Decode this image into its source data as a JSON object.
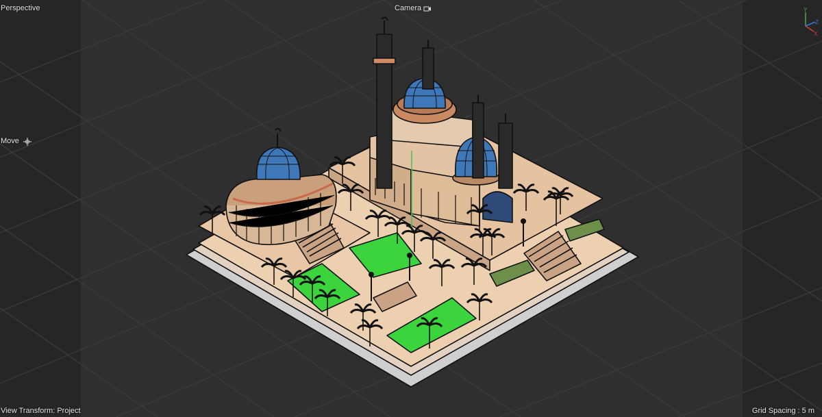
{
  "viewport": {
    "view_label": "Perspective",
    "camera_label": "Camera",
    "tool_label": "Move",
    "transform_label": "View Transform: Project",
    "grid_label": "Grid Spacing : 5 m"
  },
  "icons": {
    "camera": "camera-icon",
    "move": "move-crosshair-icon",
    "axis": "axis-gizmo-icon"
  },
  "colors": {
    "background": "#2f2f2f",
    "grid": "#3c3c3c",
    "plaza": "#e8c9a8",
    "lawn": "#3cd43c",
    "dome": "#3f78b8",
    "outline": "#111111",
    "axis_y": "#4aa84a",
    "axis_z": "#3a7ad0",
    "axis_x": "#d04040"
  }
}
